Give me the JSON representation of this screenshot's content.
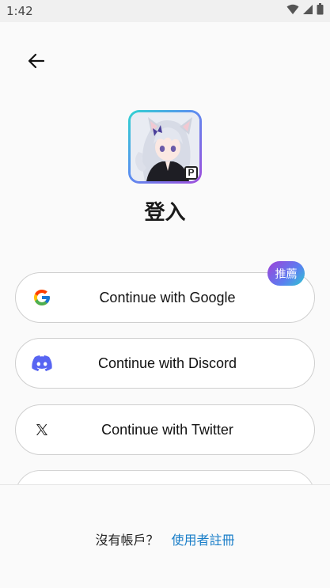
{
  "status_bar": {
    "time": "1:42",
    "icons": [
      "wifi-icon",
      "cellular-icon",
      "battery-icon"
    ]
  },
  "nav": {
    "back_icon": "arrow-left-icon"
  },
  "app": {
    "logo_badge": "P",
    "title": "登入"
  },
  "login_options": [
    {
      "label": "Continue with Google",
      "icon": "google-icon",
      "badge": "推薦"
    },
    {
      "label": "Continue with Discord",
      "icon": "discord-icon"
    },
    {
      "label": "Continue with Twitter",
      "icon": "x-twitter-icon"
    }
  ],
  "footer": {
    "question": "沒有帳戶？",
    "signup_link": "使用者註冊"
  },
  "colors": {
    "link": "#1a7ec8",
    "badge_gradient_start": "#a040d8",
    "badge_gradient_end": "#2fc8d0",
    "discord": "#5865F2"
  }
}
